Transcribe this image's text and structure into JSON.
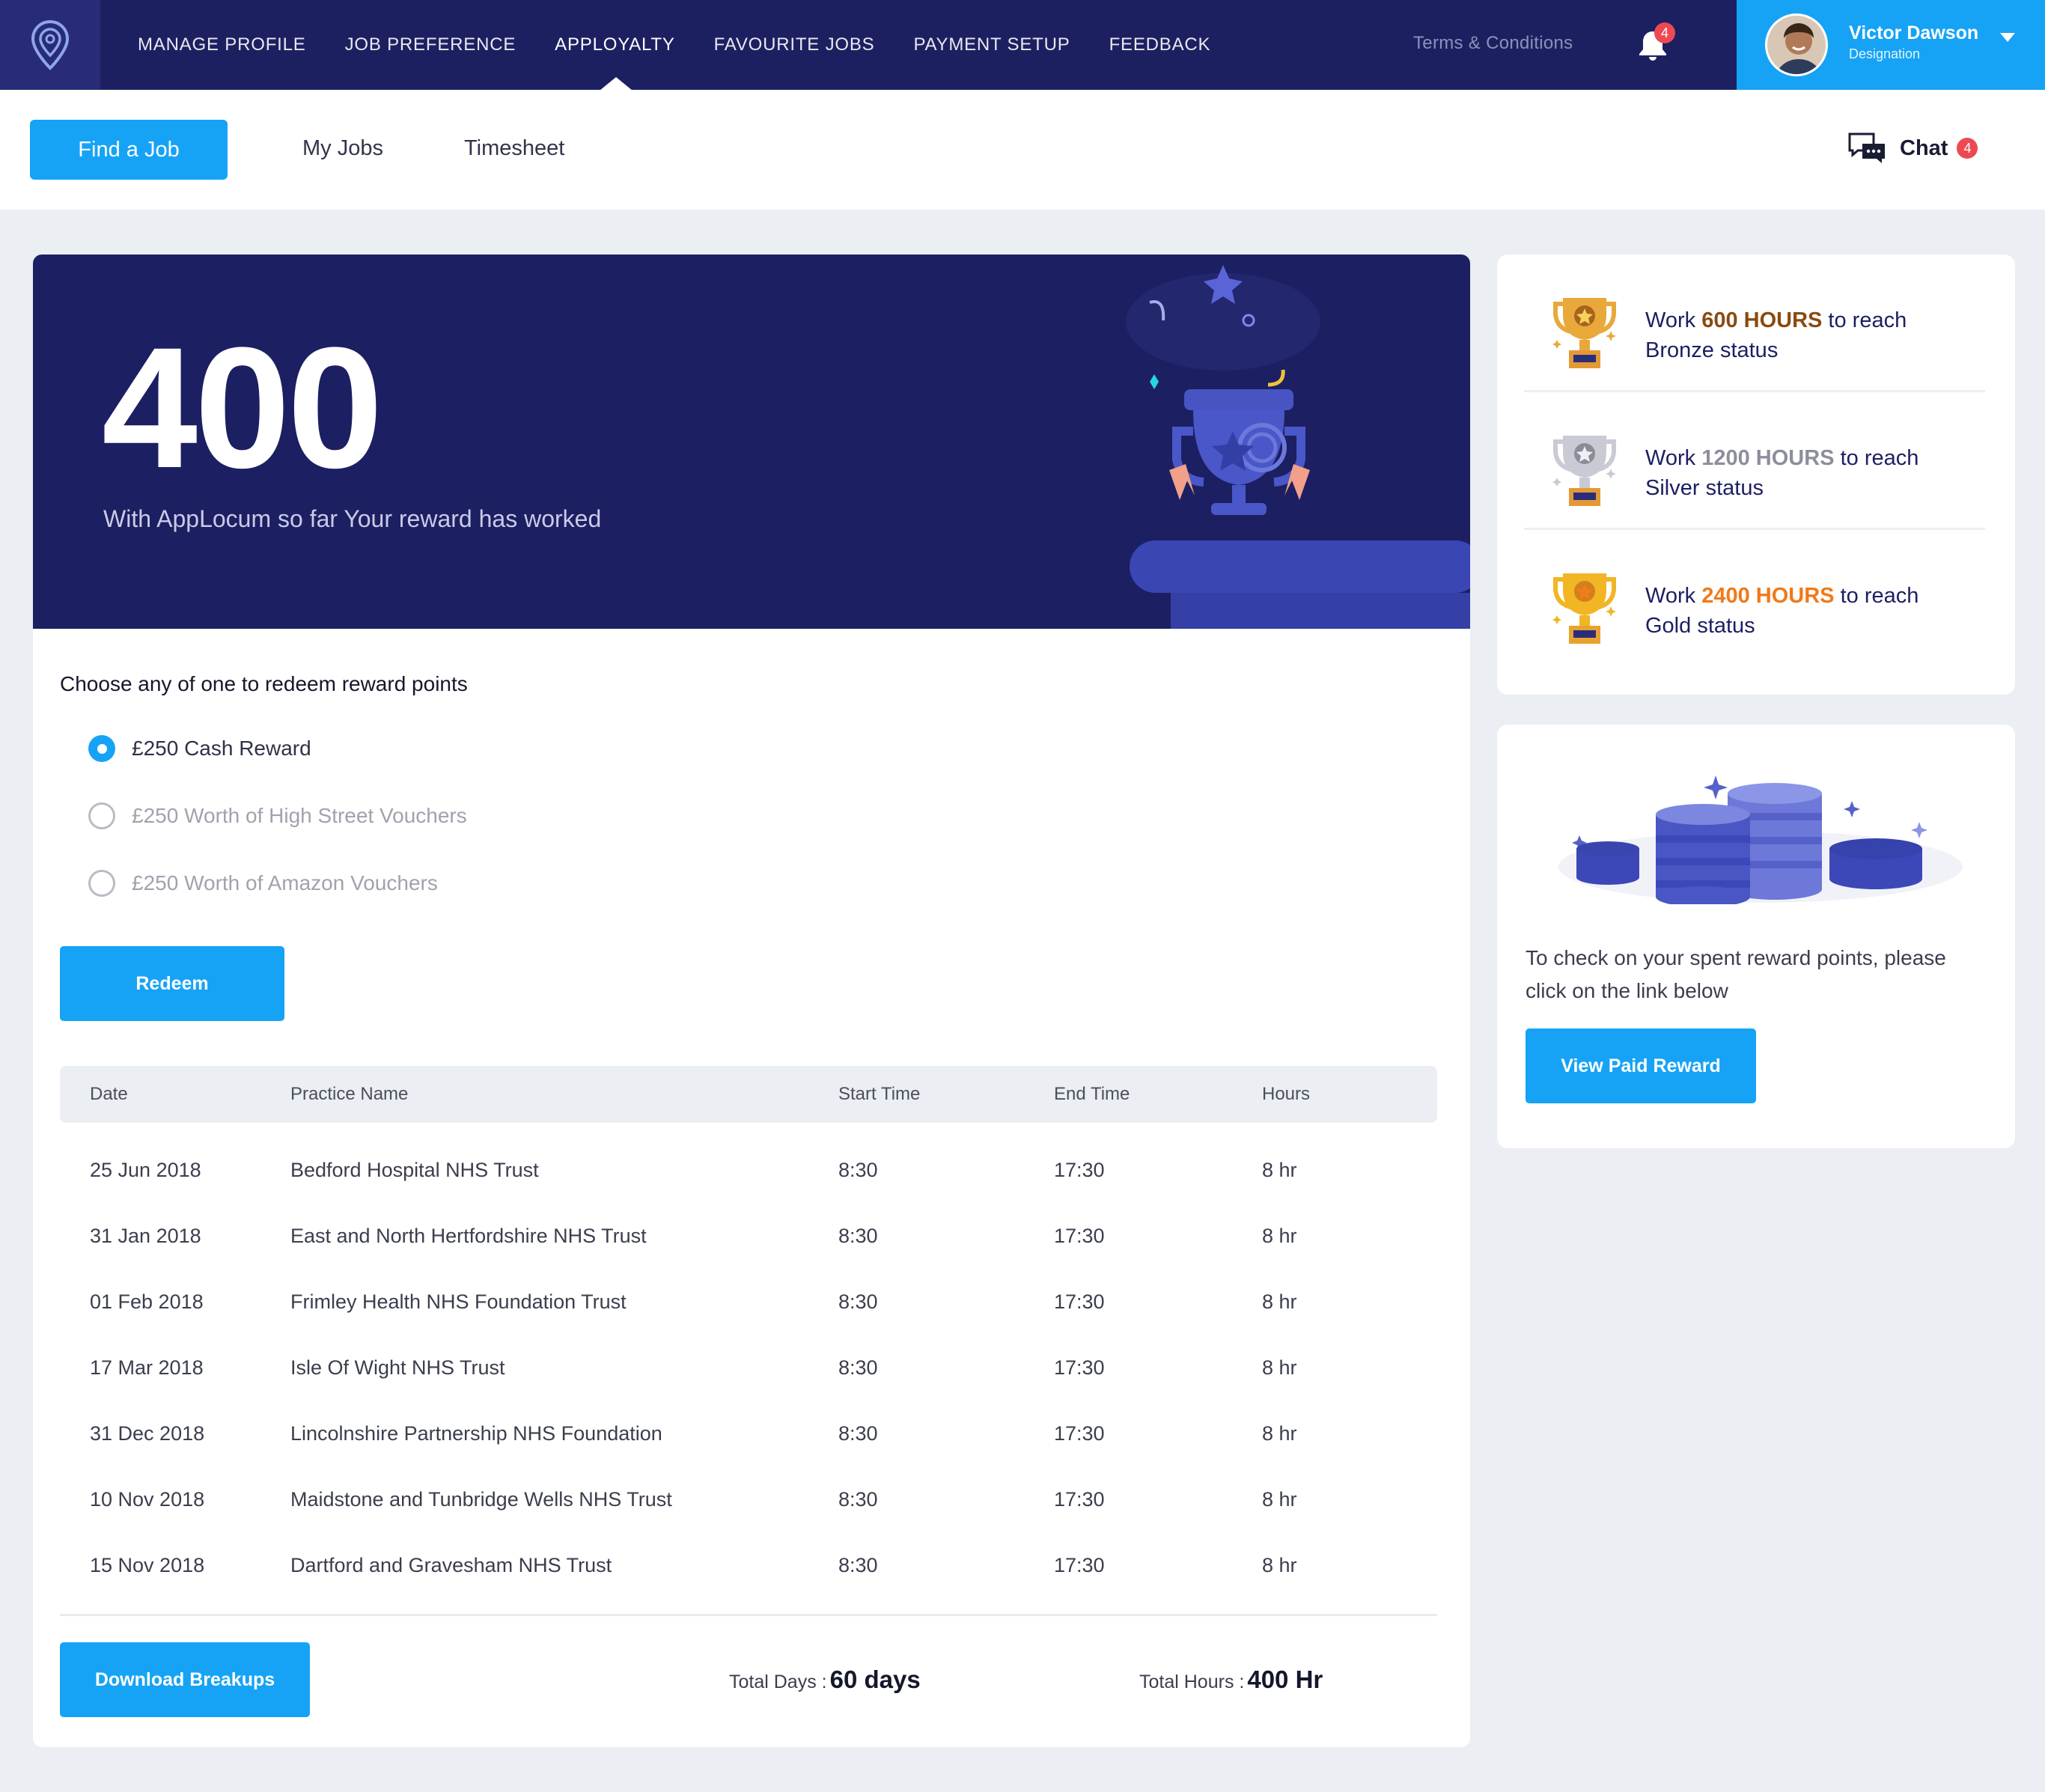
{
  "nav": {
    "items": [
      "MANAGE PROFILE",
      "JOB PREFERENCE",
      "APPLOYALTY",
      "FAVOURITE JOBS",
      "PAYMENT SETUP",
      "FEEDBACK"
    ],
    "active": "APPLOYALTY",
    "terms": "Terms & Conditions",
    "notification_count": "4",
    "logo_icon": "location-pin-icon",
    "bell_icon": "bell-icon"
  },
  "profile": {
    "name": "Victor Dawson",
    "designation": "Designation"
  },
  "subnav": {
    "find_job": "Find a Job",
    "tabs": [
      "My Jobs",
      "Timesheet"
    ],
    "chat_label": "Chat",
    "chat_count": "4",
    "chat_icon": "chat-bubbles-icon"
  },
  "hero": {
    "hours": "400",
    "subtitle": "With AppLocum so far Your reward has worked"
  },
  "redeem": {
    "title": "Choose any of one to redeem reward points",
    "options": [
      "£250 Cash Reward",
      "£250 Worth of High Street Vouchers",
      "£250 Worth of Amazon Vouchers"
    ],
    "selected_index": 0,
    "button": "Redeem"
  },
  "table": {
    "headers": [
      "Date",
      "Practice Name",
      "Start Time",
      "End Time",
      "Hours"
    ],
    "rows": [
      [
        "25 Jun 2018",
        "Bedford Hospital NHS Trust",
        "8:30",
        "17:30",
        "8 hr"
      ],
      [
        "31 Jan 2018",
        "East and North Hertfordshire NHS Trust",
        "8:30",
        "17:30",
        "8 hr"
      ],
      [
        "01 Feb 2018",
        "Frimley Health NHS Foundation Trust",
        "8:30",
        "17:30",
        "8 hr"
      ],
      [
        "17 Mar 2018",
        "Isle Of Wight NHS Trust",
        "8:30",
        "17:30",
        "8 hr"
      ],
      [
        "31 Dec 2018",
        "Lincolnshire Partnership NHS Foundation",
        "8:30",
        "17:30",
        "8 hr"
      ],
      [
        "10 Nov 2018",
        "Maidstone and Tunbridge Wells NHS Trust",
        "8:30",
        "17:30",
        "8 hr"
      ],
      [
        "15 Nov 2018",
        "Dartford and Gravesham NHS Trust",
        "8:30",
        "17:30",
        "8 hr"
      ]
    ]
  },
  "footer": {
    "download": "Download Breakups",
    "total_days_label": "Total Days :",
    "total_days": "60 days",
    "total_hours_label": "Total Hours :",
    "total_hours": "400 Hr"
  },
  "tiers": [
    {
      "pre": "Work ",
      "hours": "600 HOURS",
      "post": " to reach",
      "status": "Bronze status",
      "color": "#8a4a12",
      "trophy_icon": "bronze-trophy-icon"
    },
    {
      "pre": "Work ",
      "hours": "1200 HOURS",
      "post": " to reach",
      "status": "Silver status",
      "color": "#8d8e9c",
      "trophy_icon": "silver-trophy-icon"
    },
    {
      "pre": "Work ",
      "hours": "2400 HOURS",
      "post": " to reach",
      "status": "Gold status",
      "color": "#f07a1a",
      "trophy_icon": "gold-trophy-icon"
    }
  ],
  "paid": {
    "info": "To check on your spent reward points, please click on the link below",
    "button": "View Paid Reward"
  },
  "colors": {
    "navy": "#1d2060",
    "accent": "#16a3f6",
    "badge": "#ec4a53"
  }
}
